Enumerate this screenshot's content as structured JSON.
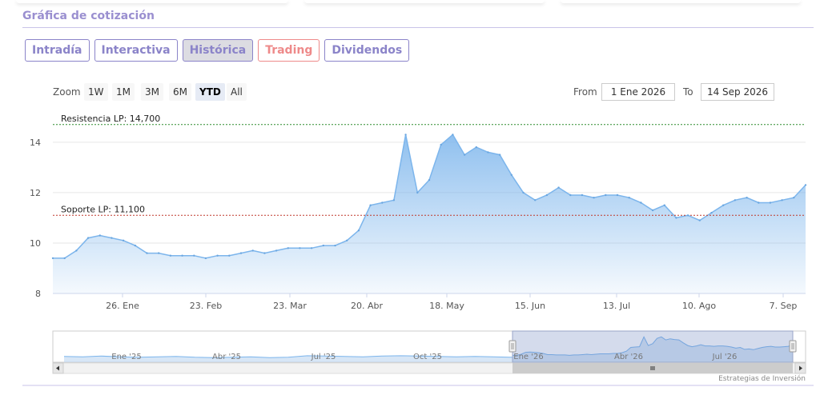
{
  "header": {
    "title": "Gráfica de cotización"
  },
  "tabs": [
    {
      "label": "Intradía",
      "state": "normal"
    },
    {
      "label": "Interactiva",
      "state": "normal"
    },
    {
      "label": "Histórica",
      "state": "active"
    },
    {
      "label": "Trading",
      "state": "red"
    },
    {
      "label": "Dividendos",
      "state": "normal"
    }
  ],
  "zoom": {
    "label": "Zoom",
    "buttons": [
      "1W",
      "1M",
      "3M",
      "6M",
      "YTD",
      "All"
    ],
    "selected": "YTD"
  },
  "range": {
    "from_label": "From",
    "from_value": "1 Ene 2026",
    "to_label": "To",
    "to_value": "14 Sep 2026"
  },
  "credits": "Estrategias de Inversión",
  "colors": {
    "accent": "#8b84c9",
    "line": "#7cb5ec",
    "resistance": "#2e8b2e",
    "support": "#c0392b"
  },
  "chart_data": {
    "type": "area",
    "x": [
      "2026-01-01",
      "2026-01-05",
      "2026-01-09",
      "2026-01-13",
      "2026-01-17",
      "2026-01-21",
      "2026-01-25",
      "2026-01-29",
      "2026-02-02",
      "2026-02-06",
      "2026-02-10",
      "2026-02-14",
      "2026-02-18",
      "2026-02-22",
      "2026-02-26",
      "2026-03-02",
      "2026-03-06",
      "2026-03-10",
      "2026-03-14",
      "2026-03-18",
      "2026-03-22",
      "2026-03-26",
      "2026-03-30",
      "2026-04-03",
      "2026-04-07",
      "2026-04-11",
      "2026-04-15",
      "2026-04-19",
      "2026-04-23",
      "2026-04-27",
      "2026-05-01",
      "2026-05-05",
      "2026-05-09",
      "2026-05-13",
      "2026-05-17",
      "2026-05-21",
      "2026-05-25",
      "2026-05-29",
      "2026-06-02",
      "2026-06-06",
      "2026-06-10",
      "2026-06-14",
      "2026-06-18",
      "2026-06-22",
      "2026-06-26",
      "2026-06-30",
      "2026-07-04",
      "2026-07-08",
      "2026-07-12",
      "2026-07-16",
      "2026-07-20",
      "2026-07-24",
      "2026-07-28",
      "2026-08-01",
      "2026-08-05",
      "2026-08-09",
      "2026-08-13",
      "2026-08-17",
      "2026-08-21",
      "2026-08-25",
      "2026-08-29",
      "2026-09-02",
      "2026-09-06",
      "2026-09-10",
      "2026-09-14"
    ],
    "series": [
      {
        "values": [
          9.4,
          9.4,
          9.7,
          10.2,
          10.3,
          10.2,
          10.1,
          9.9,
          9.6,
          9.6,
          9.5,
          9.5,
          9.5,
          9.4,
          9.5,
          9.5,
          9.6,
          9.7,
          9.6,
          9.7,
          9.8,
          9.8,
          9.8,
          9.9,
          9.9,
          10.1,
          10.5,
          11.5,
          11.6,
          11.7,
          14.3,
          12.0,
          12.5,
          13.9,
          14.3,
          13.5,
          13.8,
          13.6,
          13.5,
          12.7,
          12.0,
          11.7,
          11.9,
          12.2,
          11.9,
          11.9,
          11.8,
          11.9,
          11.9,
          11.8,
          11.6,
          11.3,
          11.5,
          11.0,
          11.1,
          10.9,
          11.2,
          11.5,
          11.7,
          11.8,
          11.6,
          11.6,
          11.7,
          11.8,
          12.3
        ]
      }
    ],
    "x_ticks": [
      "26. Ene",
      "23. Feb",
      "23. Mar",
      "20. Abr",
      "18. May",
      "15. Jun",
      "13. Jul",
      "10. Ago",
      "7. Sep"
    ],
    "y_ticks": [
      8,
      10,
      12,
      14
    ],
    "ylim": [
      8,
      15.2
    ],
    "grid": true,
    "annotations": [
      {
        "label": "Resistencia LP: 14,700",
        "value": 14.7
      },
      {
        "label": "Soporte LP: 11,100",
        "value": 11.1
      }
    ],
    "navigator": {
      "x_ticks": [
        "Ene '25",
        "Abr '25",
        "Jul '25",
        "Oct '25",
        "Ene '26",
        "Abr '26",
        "Jul '26"
      ]
    }
  }
}
